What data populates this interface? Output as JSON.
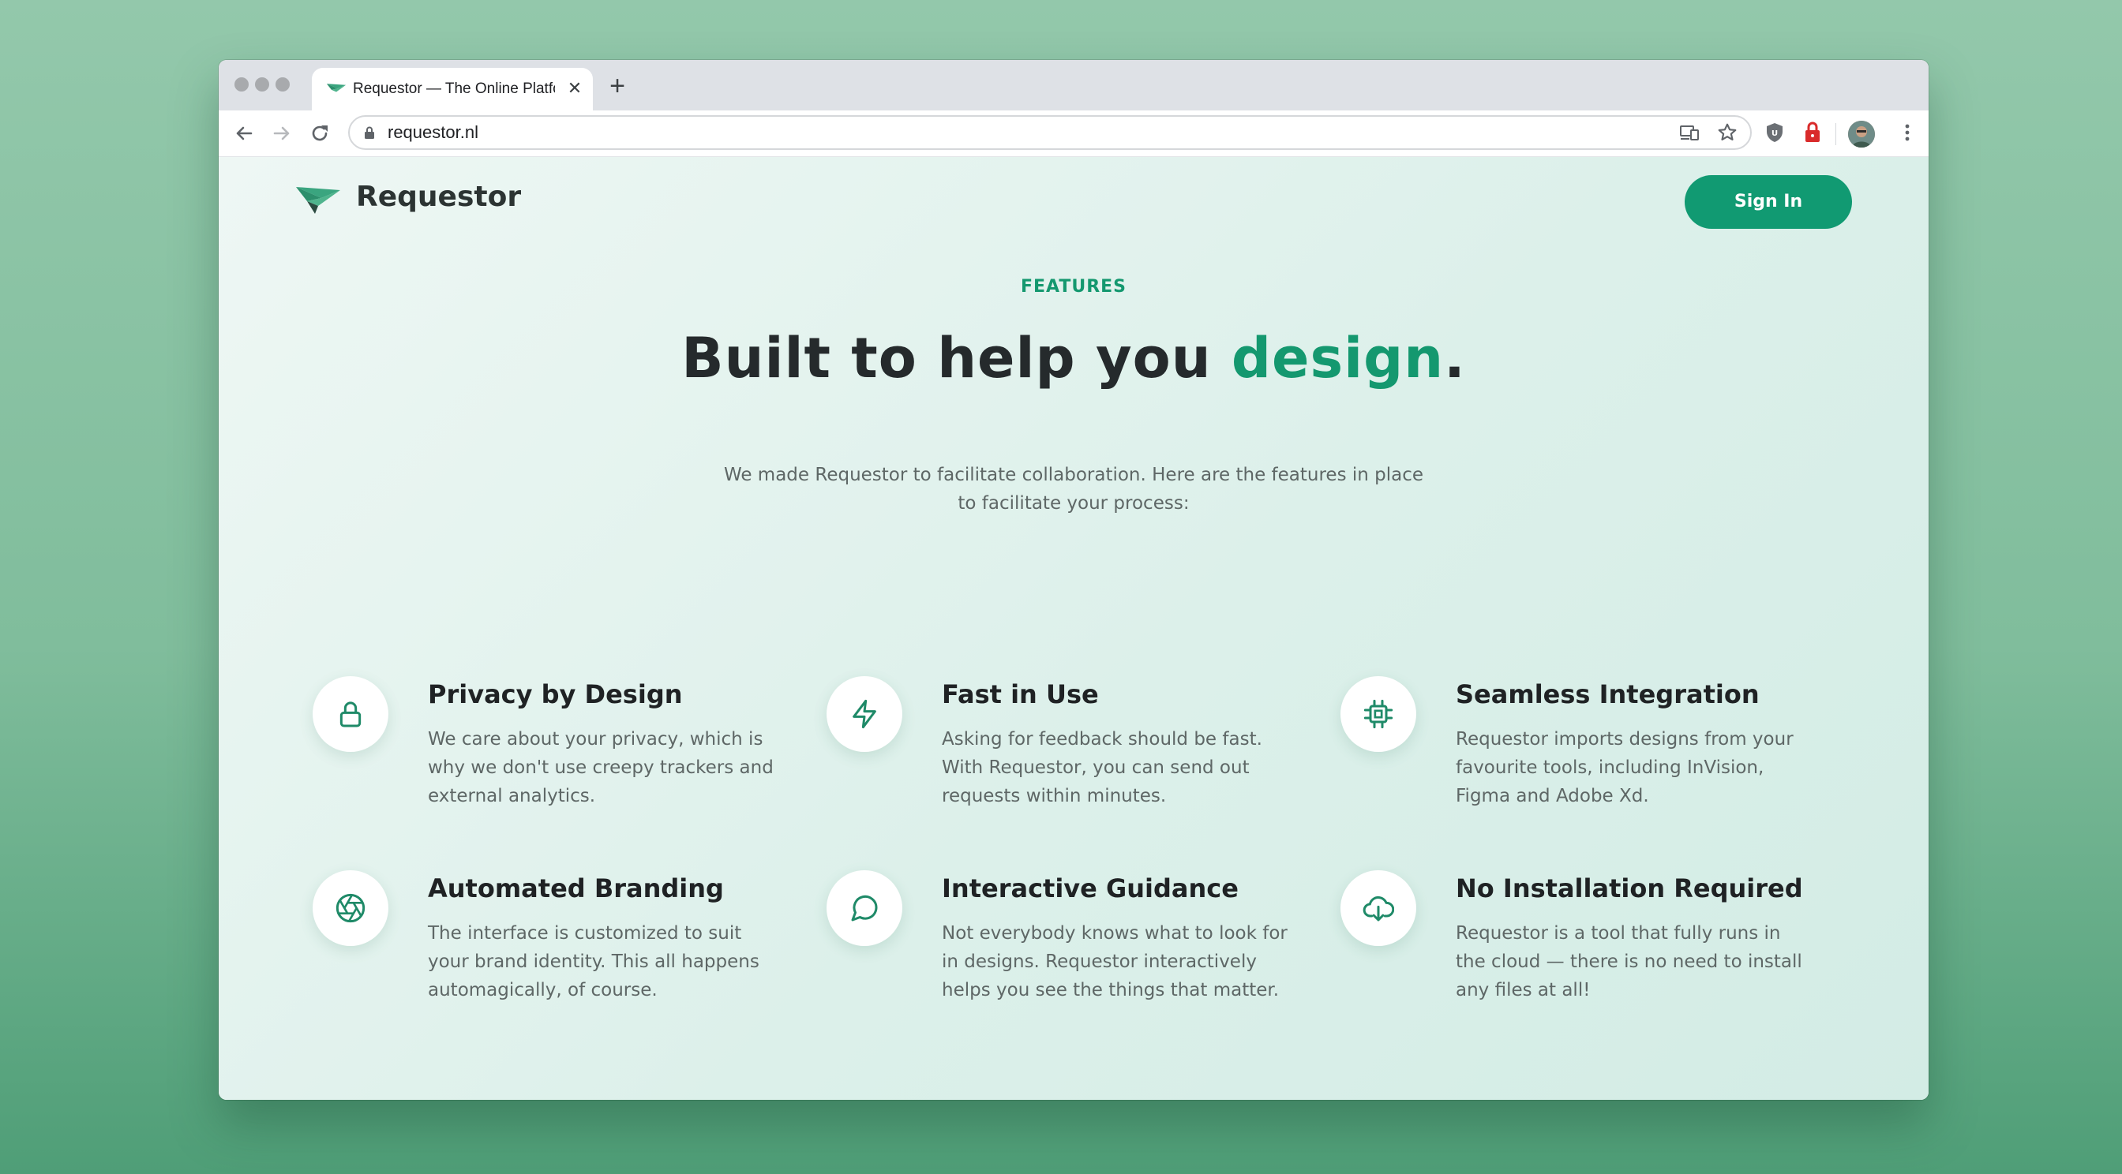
{
  "browser": {
    "tab_title": "Requestor — The Online Platfo",
    "tab_close": "✕",
    "new_tab": "+",
    "url": "requestor.nl"
  },
  "header": {
    "brand": "Requestor",
    "sign_in": "Sign In"
  },
  "hero": {
    "eyebrow": "FEATURES",
    "headline_prefix": "Built to help you ",
    "headline_accent": "design",
    "headline_suffix": ".",
    "intro": "We made Requestor to facilitate collaboration. Here are the features in place to facilitate your process:"
  },
  "features": [
    {
      "icon": "lock-icon",
      "title": "Privacy by Design",
      "desc": "We care about your privacy, which is why we don't use creepy trackers and external analytics."
    },
    {
      "icon": "lightning-icon",
      "title": "Fast in Use",
      "desc": "Asking for feedback should be fast. With Requestor, you can send out requests within minutes."
    },
    {
      "icon": "chip-icon",
      "title": "Seamless Integration",
      "desc": "Requestor imports designs from your favourite tools, including InVision, Figma and Adobe Xd."
    },
    {
      "icon": "aperture-icon",
      "title": "Automated Branding",
      "desc": "The interface is customized to suit your brand identity. This all happens automagically, of course."
    },
    {
      "icon": "chat-bubble-icon",
      "title": "Interactive Guidance",
      "desc": "Not everybody knows what to look for in designs. Requestor interactively helps you see the things that matter."
    },
    {
      "icon": "cloud-download-icon",
      "title": "No Installation Required",
      "desc": "Requestor is a tool that fully runs in the cloud — there is no need to install any files at all!"
    }
  ],
  "colors": {
    "accent": "#14986f",
    "button": "#119a72",
    "heading": "#252a2c",
    "body_text": "#5e6766"
  }
}
